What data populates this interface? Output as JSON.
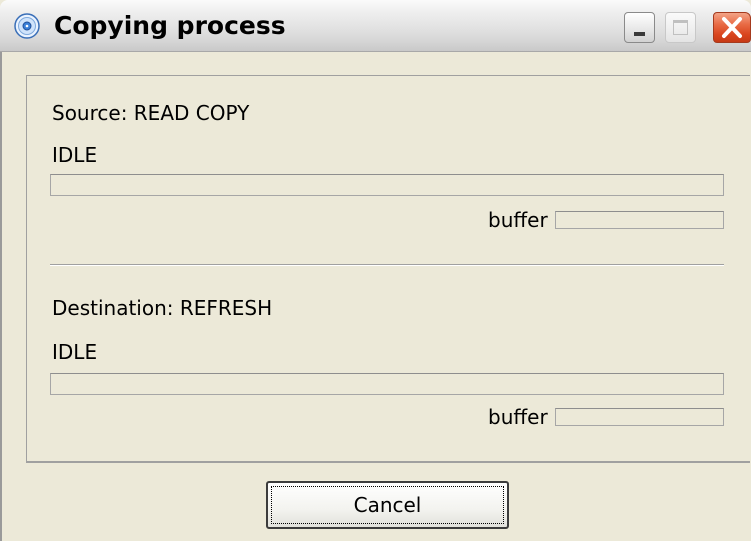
{
  "window": {
    "title": "Copying process",
    "icon": "cd-disc-icon"
  },
  "titlebar_buttons": {
    "minimize": "minimize-icon",
    "maximize": "maximize-icon",
    "close": "close-icon"
  },
  "source": {
    "label": "Source: READ COPY",
    "status": "IDLE",
    "progress_fraction": 0,
    "buffer_label": "buffer",
    "buffer_fraction": 0
  },
  "destination": {
    "label": "Destination: REFRESH",
    "status": "IDLE",
    "progress_fraction": 0,
    "buffer_label": "buffer",
    "buffer_fraction": 0
  },
  "actions": {
    "cancel_label": "Cancel"
  },
  "colors": {
    "window_bg": "#ece9d8",
    "close_button": "#d9441d",
    "progress_fill": "#3c8a3c"
  }
}
